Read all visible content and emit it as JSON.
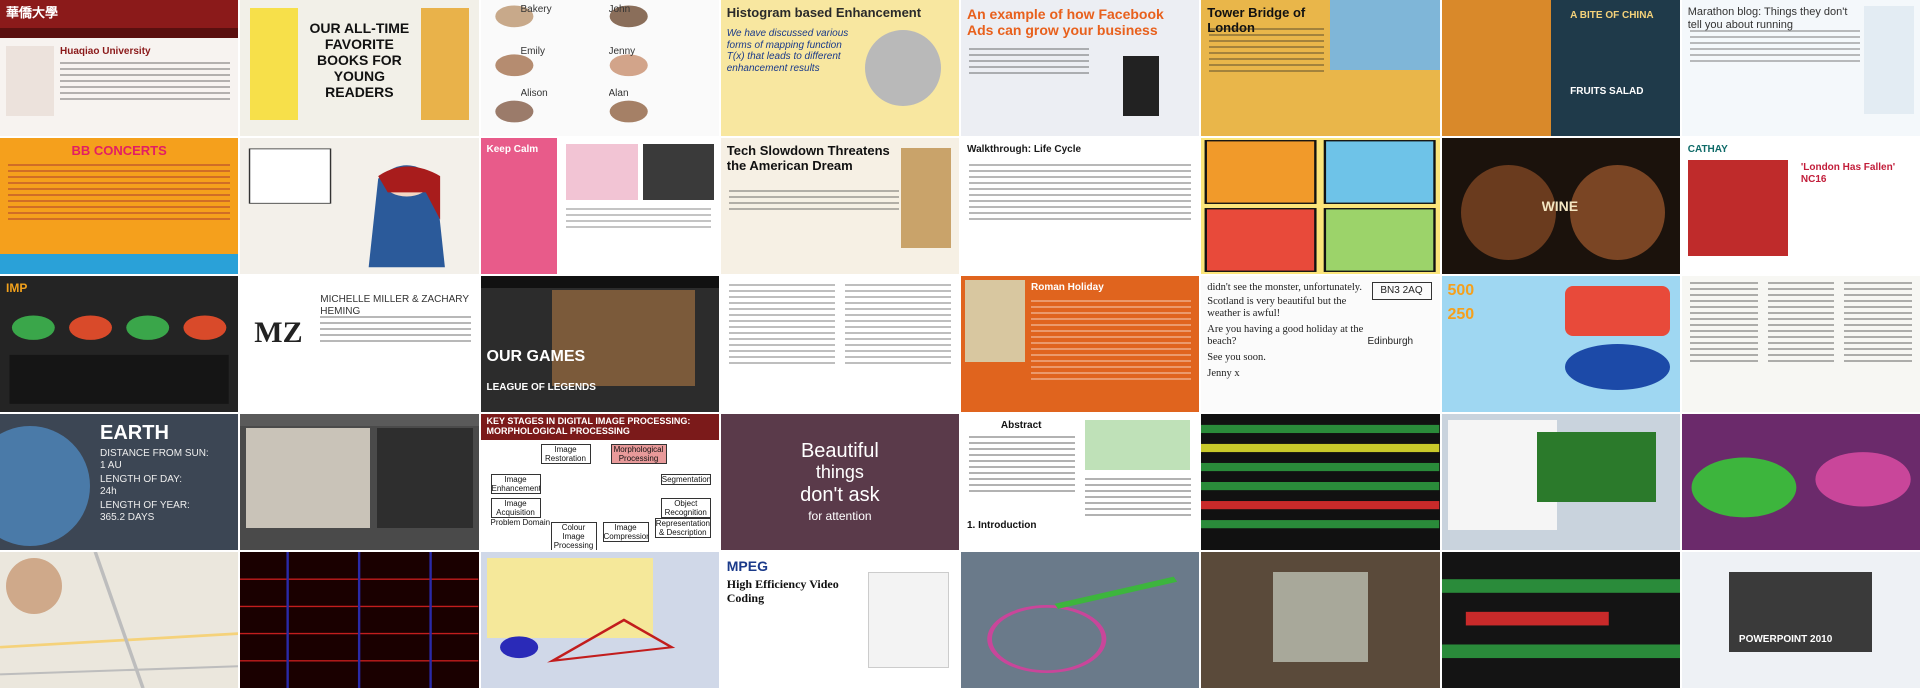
{
  "tiles": {
    "r1c1": {
      "logo": "華僑大學",
      "heading": "Huaqiao University"
    },
    "r1c2": {
      "title": "OUR ALL-TIME FAVORITE BOOKS FOR YOUNG READERS"
    },
    "r1c3": {
      "names": [
        "Bakery",
        "John",
        "Emily",
        "Jenny",
        "Alison",
        "Alan"
      ]
    },
    "r1c4": {
      "title": "Histogram based Enhancement",
      "body": "We have discussed various forms of mapping function T(x) that leads to different enhancement results"
    },
    "r1c5": {
      "title": "An example of how Facebook Ads can grow your business"
    },
    "r1c6": {
      "title": "Tower Bridge of London"
    },
    "r1c7": {
      "title": "A BITE OF CHINA",
      "sub": "FRUITS SALAD"
    },
    "r1c8": {
      "title": "Marathon blog: Things they don't tell you about running"
    },
    "r2c1": {
      "title": "BB CONCERTS"
    },
    "r2c3": {
      "title": "Keep Calm"
    },
    "r2c4": {
      "title": "Tech Slowdown Threatens the American Dream"
    },
    "r2c5": {
      "item": "Walkthrough: Life Cycle"
    },
    "r2c7": {
      "label": "WINE"
    },
    "r2c8": {
      "brand": "CATHAY",
      "headline": "'London Has Fallen' NC16"
    },
    "r3c1": {
      "brand": "IMP"
    },
    "r3c2": {
      "names": "MICHELLE MILLER & ZACHARY HEMING",
      "mono": "MZ"
    },
    "r3c3": {
      "title": "OUR GAMES",
      "sub": "LEAGUE OF LEGENDS"
    },
    "r3c5": {
      "title": "Roman Holiday"
    },
    "r3c6": {
      "line1": "didn't see the monster, unfortunately.",
      "line2": "Scotland is very beautiful but the weather is awful!",
      "line3": "Are you having a good holiday at the beach?",
      "line4": "See you soon.",
      "line5": "Jenny x",
      "code": "BN3 2AQ",
      "town": "Edinburgh"
    },
    "r3c7": {
      "num1": "500",
      "num2": "250"
    },
    "r4c1": {
      "title": "EARTH",
      "l1": "DISTANCE FROM SUN:",
      "l2": "1 AU",
      "l3": "LENGTH OF DAY:",
      "l4": "24h",
      "l5": "LENGTH OF YEAR:",
      "l6": "365.2 DAYS"
    },
    "r4c3": {
      "title": "KEY STAGES IN DIGITAL IMAGE PROCESSING: MORPHOLOGICAL PROCESSING",
      "boxes": [
        "Image Restoration",
        "Morphological Processing",
        "Image Enhancement",
        "Segmentation",
        "Image Acquisition",
        "Object Recognition",
        "Problem Domain",
        "Representation & Description",
        "Colour Image Processing",
        "Image Compression"
      ]
    },
    "r4c4": {
      "l1": "Beautiful",
      "l2": "things",
      "l3": "don't ask",
      "l4": "for attention"
    },
    "r4c5": {
      "title": "Abstract",
      "sec": "1. Introduction"
    },
    "r5c3": {
      "title": "MPEG",
      "sub": "High Efficiency Video Coding"
    },
    "r5c8": {
      "title": "POWERPOINT 2010"
    }
  },
  "colors": {
    "maroon": "#8b1a1a",
    "yellow": "#f7e04a",
    "orange": "#e8601c",
    "teal": "#16a2b8",
    "dark": "#1f1f1f",
    "sky": "#9fd7f2",
    "green": "#2a8b3a",
    "purple": "#7b2a7b"
  }
}
